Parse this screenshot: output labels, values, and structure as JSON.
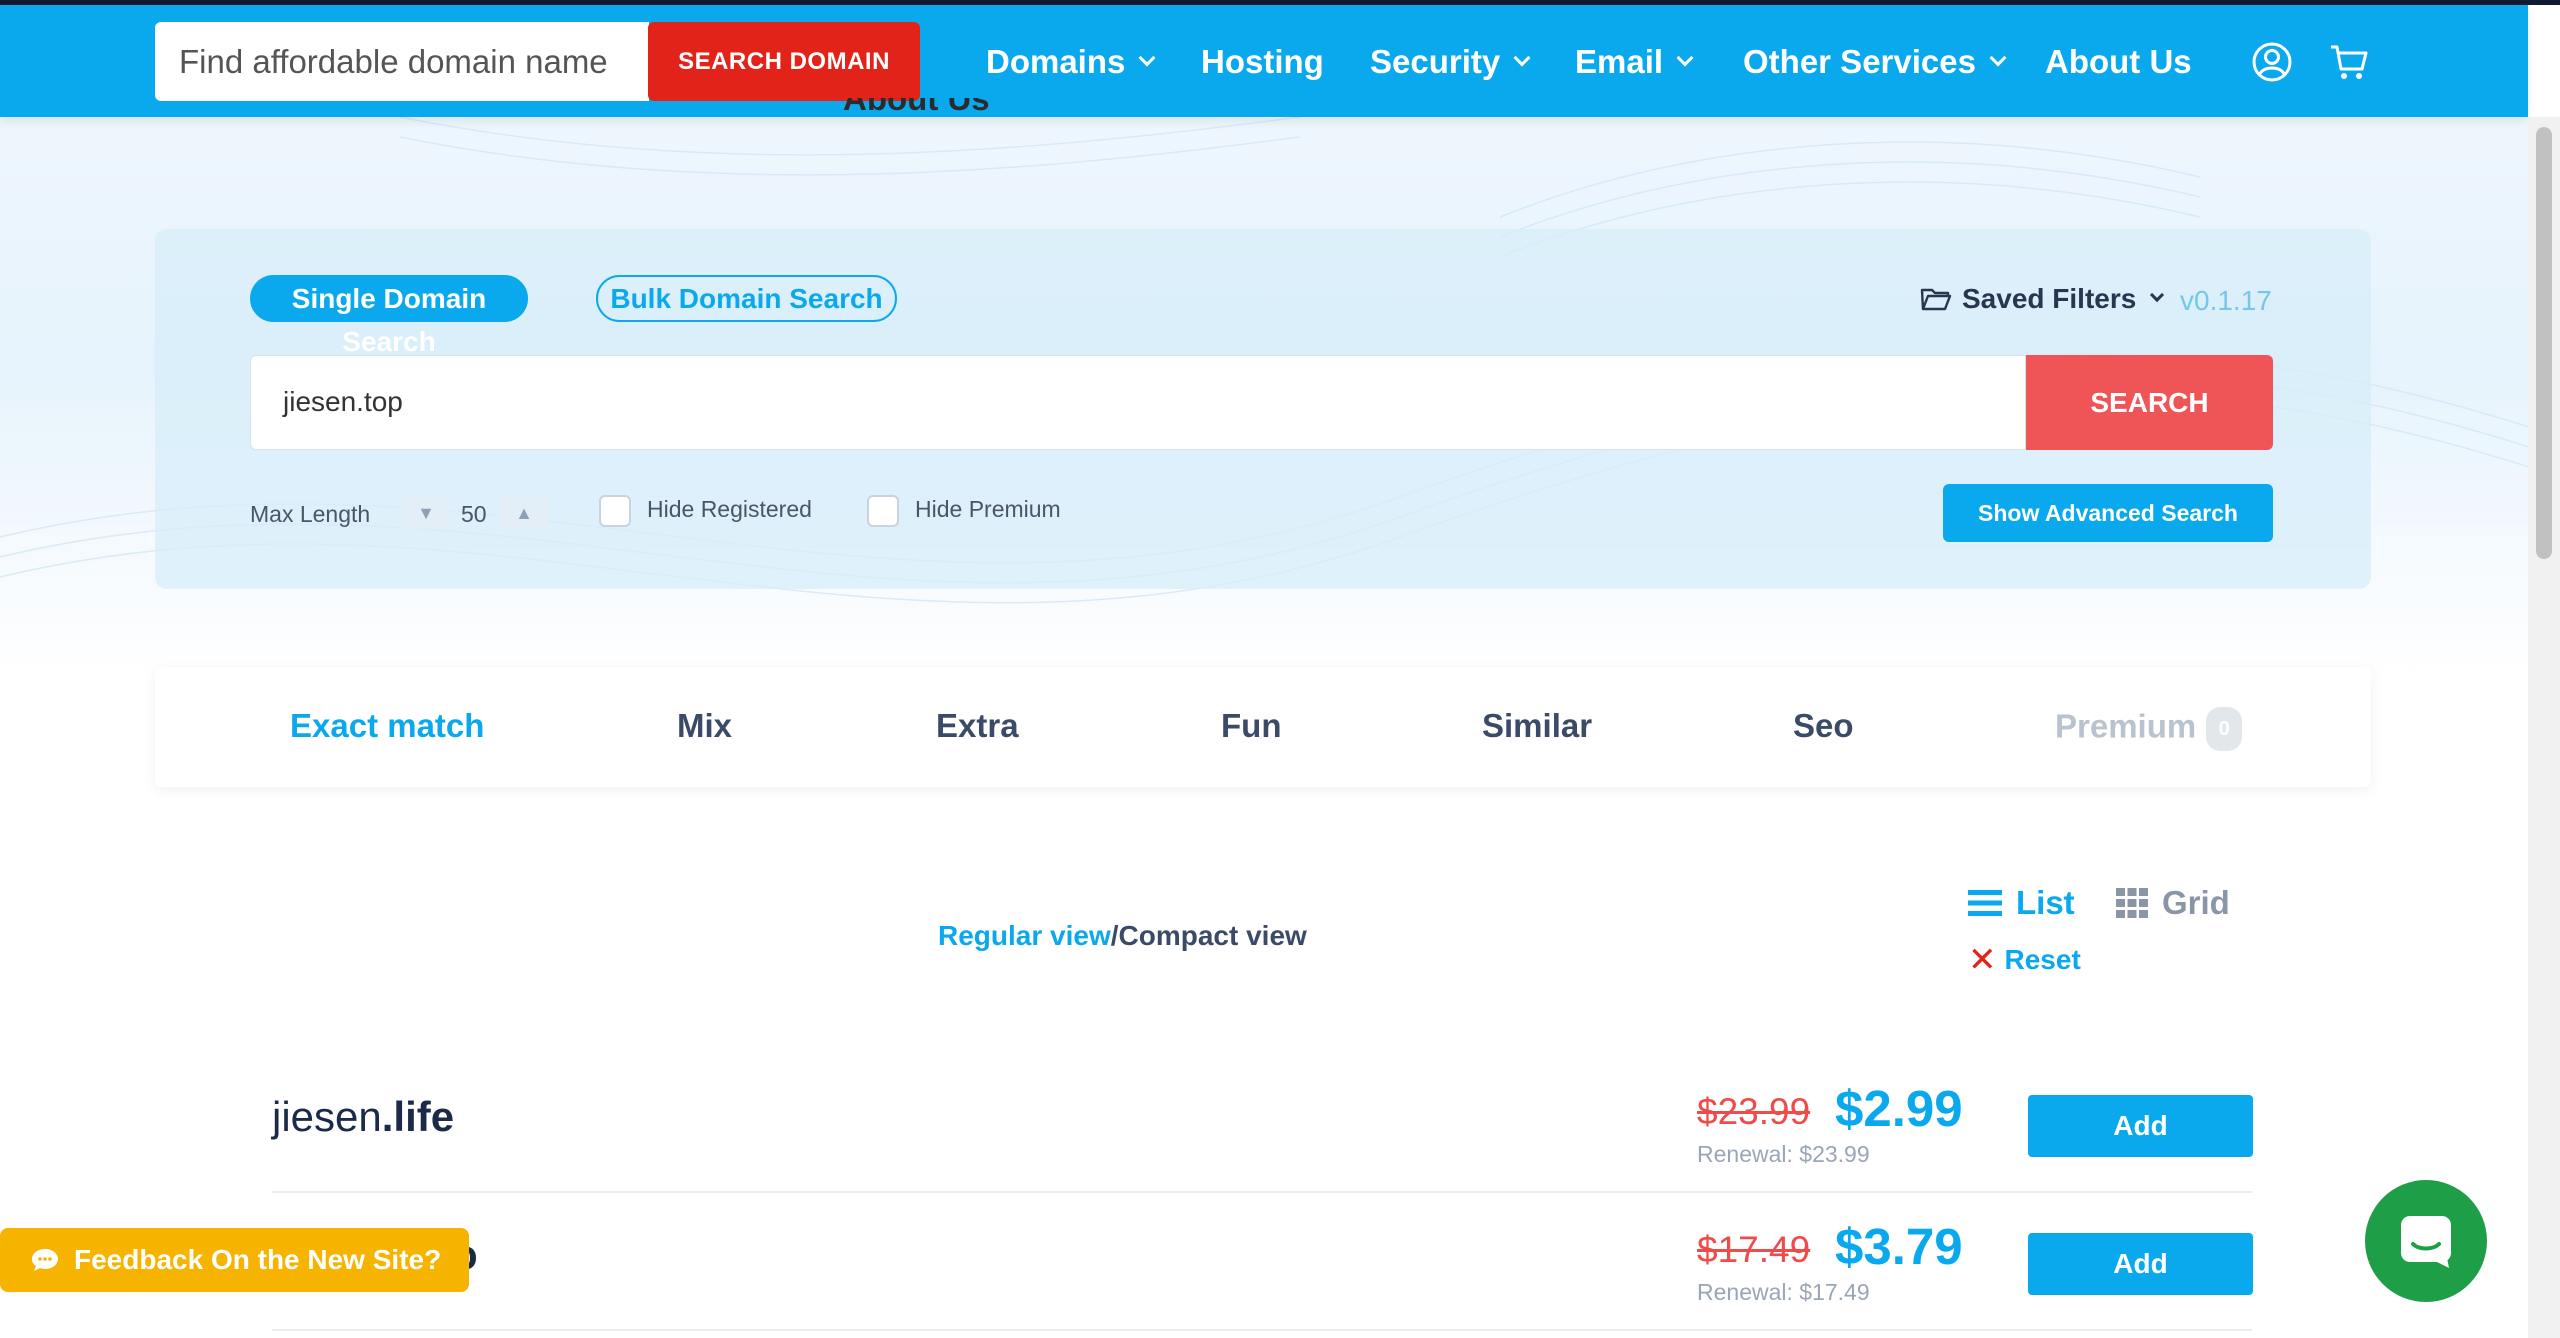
{
  "header": {
    "search_placeholder": "Find affordable domain name",
    "search_button": "SEARCH DOMAIN",
    "nav": [
      {
        "label": "Domains"
      },
      {
        "label": "Hosting"
      },
      {
        "label": "Security"
      },
      {
        "label": "Email"
      },
      {
        "label": "Other Services"
      },
      {
        "label": "About Us"
      }
    ],
    "ghost_label": "About Us"
  },
  "search_panel": {
    "tab_single": "Single Domain Search",
    "tab_bulk": "Bulk Domain Search",
    "saved_filters": "Saved Filters",
    "version": "v0.1.17",
    "query": "jiesen.top",
    "search_button": "SEARCH",
    "max_length_label": "Max Length",
    "max_length_value": "50",
    "stepper_down": "▼",
    "stepper_up": "▲",
    "hide_registered": "Hide Registered",
    "hide_premium": "Hide Premium",
    "advanced_button": "Show Advanced Search"
  },
  "result_tabs": [
    {
      "label": "Exact match"
    },
    {
      "label": "Mix"
    },
    {
      "label": "Extra"
    },
    {
      "label": "Fun"
    },
    {
      "label": "Similar"
    },
    {
      "label": "Seo"
    },
    {
      "label": "Premium",
      "badge": "0"
    }
  ],
  "view": {
    "regular": "Regular view",
    "separator": "/",
    "compact": "Compact view",
    "list": "List",
    "grid": "Grid",
    "reset_icon": "✕",
    "reset": "Reset"
  },
  "results": [
    {
      "name": "jiesen",
      "tld": ".life",
      "old_price": "$23.99",
      "price": "$2.99",
      "renewal": "Renewal: $23.99",
      "action": "Add"
    },
    {
      "name": "",
      "tld": "o",
      "old_price": "$17.49",
      "price": "$3.79",
      "renewal": "Renewal: $17.49",
      "action": "Add"
    }
  ],
  "feedback": "Feedback On the New Site?",
  "colors": {
    "brand": "#0aa9ee",
    "danger": "#e2231a",
    "search_button": "#ef5457",
    "feedback": "#f6b300",
    "chat": "#1e9e46"
  },
  "icons": [
    "user-icon",
    "cart-icon",
    "folder-icon",
    "list-icon",
    "grid-icon",
    "close-icon",
    "chat-icon",
    "comment-icon",
    "chevron-down-icon"
  ]
}
